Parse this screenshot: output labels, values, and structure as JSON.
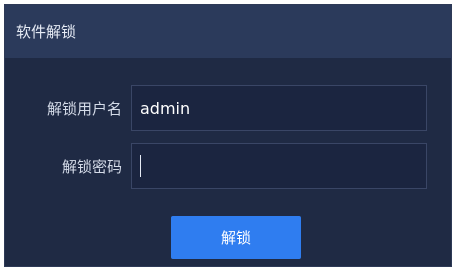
{
  "dialog": {
    "title": "软件解锁"
  },
  "form": {
    "username_label": "解锁用户名",
    "username_value": "admin",
    "password_label": "解锁密码",
    "password_value": ""
  },
  "actions": {
    "unlock_label": "解锁"
  },
  "colors": {
    "dialog_bg": "#1f2a44",
    "titlebar_bg": "#2b3a5b",
    "input_bg": "#1b2540",
    "input_border": "#3a4666",
    "button_bg": "#2f7df0"
  }
}
